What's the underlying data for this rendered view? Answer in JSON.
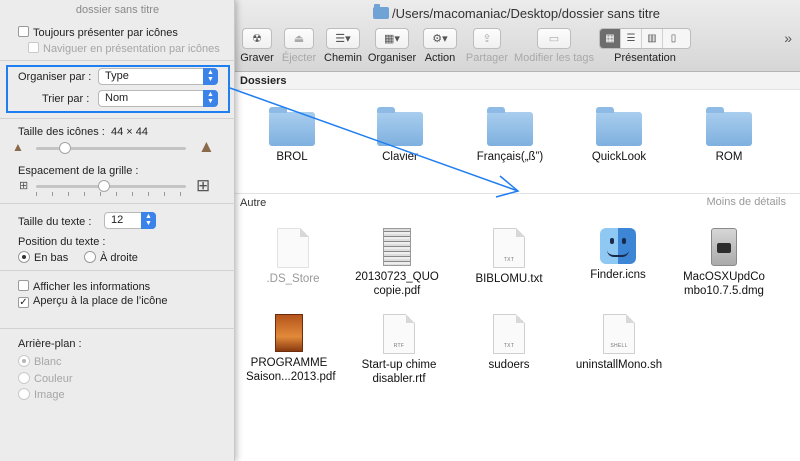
{
  "finder": {
    "title": "/Users/macomaniac/Desktop/dossier sans titre",
    "toolbar": [
      {
        "label": "Graver",
        "glyph": "☢",
        "disabled": false
      },
      {
        "label": "Éjecter",
        "glyph": "⏏",
        "disabled": true
      },
      {
        "label": "Chemin",
        "glyph": "☰▾",
        "disabled": false
      },
      {
        "label": "Organiser",
        "glyph": "▦▾",
        "disabled": false
      },
      {
        "label": "Action",
        "glyph": "⚙▾",
        "disabled": false
      },
      {
        "label": "Partager",
        "glyph": "⇪",
        "disabled": true
      },
      {
        "label": "Modifier les tags",
        "glyph": "▭",
        "disabled": true
      }
    ],
    "view_label": "Présentation",
    "overflow": "»",
    "sections": {
      "dossiers": "Dossiers",
      "autre": "Autre",
      "moins_details": "Moins de détails"
    },
    "folders": [
      "BROL",
      "Clavier",
      "Français(„ß”)",
      "QuickLook",
      "ROM"
    ],
    "files": [
      {
        "name": ".DS_Store",
        "kind": "blank",
        "dim": true
      },
      {
        "name": "20130723_QUO copie.pdf",
        "kind": "pdf"
      },
      {
        "name": "BIBLOMU.txt",
        "kind": "doc",
        "tag": "TXT"
      },
      {
        "name": "Finder.icns",
        "kind": "finder"
      },
      {
        "name": "MacOSXUpdCombo10.7.5.dmg",
        "kind": "dmg"
      },
      {
        "name": "PROGRAMME Saison...2013.pdf",
        "kind": "pdf-orange"
      },
      {
        "name": "Start-up chime disabler.rtf",
        "kind": "doc",
        "tag": "RTF"
      },
      {
        "name": "sudoers",
        "kind": "doc",
        "tag": "TXT"
      },
      {
        "name": "uninstallMono.sh",
        "kind": "doc",
        "tag": "SHELL"
      }
    ]
  },
  "panel": {
    "title": "dossier sans titre",
    "always_show": "Toujours présenter par icônes",
    "browse_icons": "Naviguer en présentation par icônes",
    "arrange_label": "Organiser par :",
    "arrange_value": "Type",
    "sort_label": "Trier par :",
    "sort_value": "Nom",
    "icon_size_label": "Taille des icônes :",
    "icon_size_value": "44 × 44",
    "icon_size_level": 0.17,
    "grid_label": "Espacement de la grille :",
    "grid_level": 0.45,
    "text_size_label": "Taille du texte :",
    "text_size_value": "12",
    "label_pos_label": "Position du texte :",
    "label_bottom": "En bas",
    "label_right": "À droite",
    "show_info": "Afficher les informations",
    "show_preview": "Aperçu à la place de l’icône",
    "background_label": "Arrière-plan :",
    "bg_white": "Blanc",
    "bg_color": "Couleur",
    "bg_image": "Image"
  },
  "colors": {
    "highlight": "#1f7ef0",
    "accent": "#3b83e8"
  }
}
